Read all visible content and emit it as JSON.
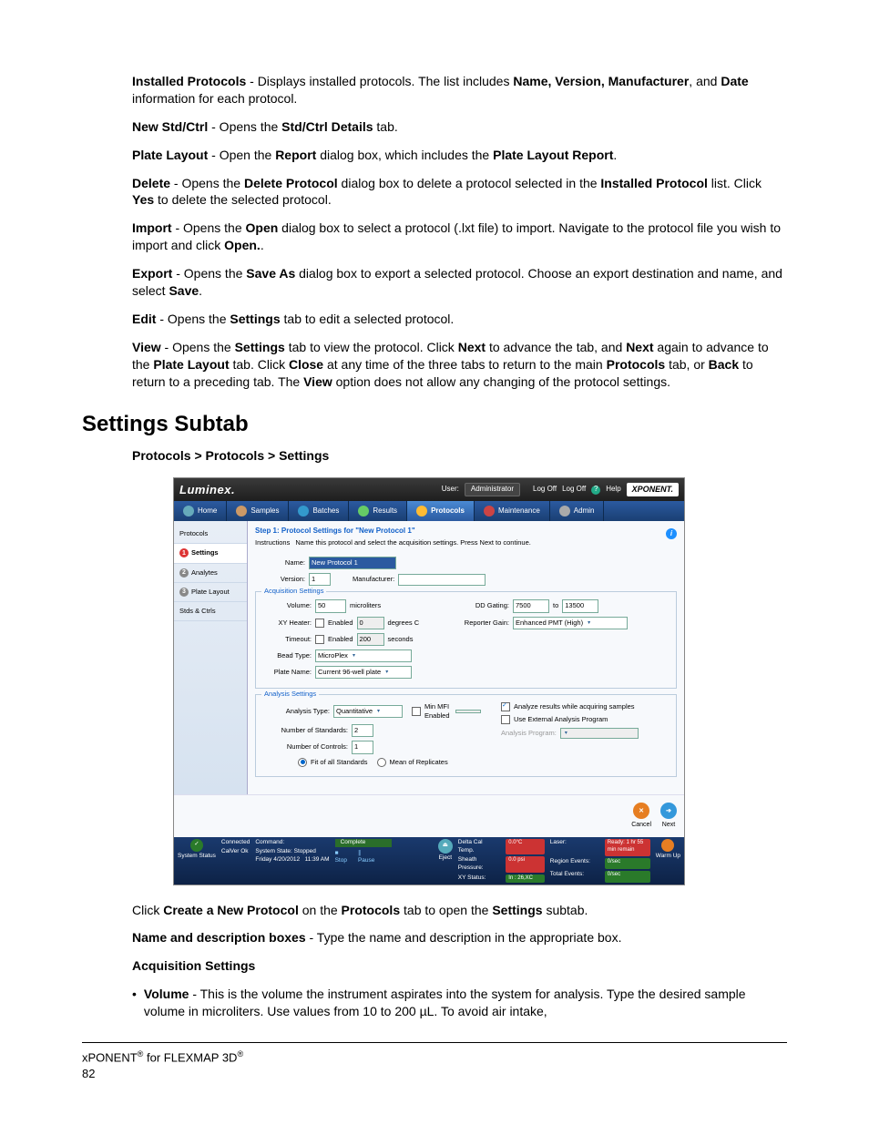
{
  "intro": {
    "installed_protocols": {
      "b1": "Installed Protocols",
      "t1": " - Displays installed protocols. The list includes ",
      "b2": "Name, Version, Manufacturer",
      "t2": ", and ",
      "b3": "Date",
      "t3": " information for each protocol."
    },
    "new_stdctrl": {
      "b1": "New Std/Ctrl",
      "t1": " -  Opens the ",
      "b2": "Std/Ctrl Details",
      "t2": " tab."
    },
    "plate_layout": {
      "b1": "Plate Layout",
      "t1": " -  Open the ",
      "b2": "Report",
      "t2": " dialog box, which includes the ",
      "b3": "Plate Layout Report",
      "t3": "."
    },
    "delete": {
      "b1": "Delete",
      "t1": " -  Opens the ",
      "b2": "Delete Protocol",
      "t2": " dialog box to delete a protocol selected in the ",
      "b3": "Installed Protocol",
      "t3": " list. Click ",
      "b4": "Yes",
      "t4": " to delete the selected protocol."
    },
    "import": {
      "b1": "Import",
      "t1": " -  Opens the ",
      "b2": "Open",
      "t2": " dialog box to select a protocol (.lxt file) to import. Navigate to the protocol file you wish to import and click ",
      "b3": "Open.",
      "t3": "."
    },
    "export": {
      "b1": "Export",
      "t1": " -  Opens the ",
      "b2": "Save As",
      "t2": " dialog box to export a selected protocol. Choose an export destination and name, and select ",
      "b3": "Save",
      "t3": "."
    },
    "edit": {
      "b1": "Edit",
      "t1": " -  Opens the ",
      "b2": "Settings",
      "t2": " tab to edit a selected protocol."
    },
    "view": {
      "b1": "View",
      "t1": " -  Opens the ",
      "b2": "Settings",
      "t2": " tab to view the protocol. Click ",
      "b3": "Next",
      "t3": " to advance the tab, and ",
      "b4": "Next",
      "t4": " again to advance to the ",
      "b5": "Plate Layout",
      "t5": " tab. Click ",
      "b6": "Close",
      "t6": " at any time of the three tabs to return to the main ",
      "b7": "Protocols",
      "t7": " tab, or ",
      "b8": "Back",
      "t8": " to return to a preceding tab. The ",
      "b9": "View",
      "t9": " option does not allow any changing of the protocol settings."
    }
  },
  "section_title": "Settings Subtab",
  "breadcrumb": {
    "a": "Protocols",
    "sep": " > ",
    "b": "Protocols",
    "c": "Settings"
  },
  "ss": {
    "logo": "Luminex.",
    "user_label": "User:",
    "user_value": "Administrator",
    "logoff": "Log Off",
    "help": "Help",
    "brand": "XPONENT.",
    "nav": {
      "home": "Home",
      "samples": "Samples",
      "batches": "Batches",
      "results": "Results",
      "protocols": "Protocols",
      "maintenance": "Maintenance",
      "admin": "Admin"
    },
    "sidebar": {
      "protocols": "Protocols",
      "settings": "Settings",
      "analytes": "Analytes",
      "plate_layout": "Plate Layout",
      "stds_ctrls": "Stds & Ctrls"
    },
    "step_line": "Step 1: Protocol Settings for \"New Protocol 1\"",
    "instr_label": "Instructions",
    "instr_text": "Name this protocol and select the acquisition settings.  Press Next to continue.",
    "name_label": "Name:",
    "name_value": "New Protocol 1",
    "version_label": "Version:",
    "version_value": "1",
    "manufacturer_label": "Manufacturer:",
    "acq": {
      "legend": "Acquisition Settings",
      "volume_label": "Volume:",
      "volume_value": "50",
      "volume_unit": "microliters",
      "xy_label": "XY Heater:",
      "xy_enabled": "Enabled",
      "xy_value": "0",
      "xy_unit": "degrees C",
      "timeout_label": "Timeout:",
      "timeout_enabled": "Enabled",
      "timeout_value": "200",
      "timeout_unit": "seconds",
      "bead_label": "Bead Type:",
      "bead_value": "MicroPlex",
      "plate_label": "Plate Name:",
      "plate_value": "Current 96-well plate",
      "dd_label": "DD Gating:",
      "dd_from": "7500",
      "dd_to_label": "to",
      "dd_to": "13500",
      "gain_label": "Reporter Gain:",
      "gain_value": "Enhanced PMT (High)"
    },
    "ana": {
      "legend": "Analysis Settings",
      "type_label": "Analysis Type:",
      "type_value": "Quantitative",
      "minmfi_label": "Min MFI Enabled",
      "nstd_label": "Number of Standards:",
      "nstd_value": "2",
      "nctrl_label": "Number of Controls:",
      "nctrl_value": "1",
      "fit_label": "Fit of all Standards",
      "mean_label": "Mean of Replicates",
      "analyze_while": "Analyze results while acquiring samples",
      "use_ext": "Use External Analysis Program",
      "ext_label": "Analysis Program:"
    },
    "btn_cancel": "Cancel",
    "btn_next": "Next",
    "status": {
      "connected": "Connected",
      "cmd": "Command:",
      "complete": "Complete",
      "state_label": "System State:",
      "state": "Stopped",
      "date": "Friday 4/20/2012",
      "time": "11:39 AM",
      "stop": "Stop",
      "pause": "Pause",
      "eject": "Eject",
      "dcal": "Delta Cal Temp.",
      "dcal_v": "0.0°C",
      "sheath": "Sheath Pressure:",
      "sheath_v": "0.0 psi",
      "xy": "XY Status:",
      "xy_v": "In : 26,XC",
      "laser": "Laser:",
      "laser_v": "Ready: 1 hr 55 min remain",
      "region": "Region Events:",
      "region_v": "0/sec",
      "total": "Total Events:",
      "total_v": "0/sec",
      "warmup": "Warm Up",
      "sysstatus": "System Status",
      "calver": "CalVer Ok"
    }
  },
  "after": {
    "p1": {
      "t1": "Click ",
      "b1": "Create a New Protocol",
      "t2": " on the ",
      "b2": "Protocols",
      "t3": " tab to open the ",
      "b3": "Settings",
      "t4": " subtab."
    },
    "p2": {
      "b1": "Name and description boxes",
      "t1": " - Type the name and description in the appropriate box."
    },
    "p3": {
      "b1": "Acquisition Settings"
    },
    "vol": {
      "b1": "Volume",
      "t1": " - This is the volume the instrument aspirates into the system for analysis. Type the desired sample volume in microliters. Use values from 10 to 200 µL. To avoid air intake,"
    }
  },
  "footer": {
    "line1a": "xPONENT",
    "line1b": " for FLEXMAP 3D",
    "page": "82",
    "reg": "®"
  }
}
